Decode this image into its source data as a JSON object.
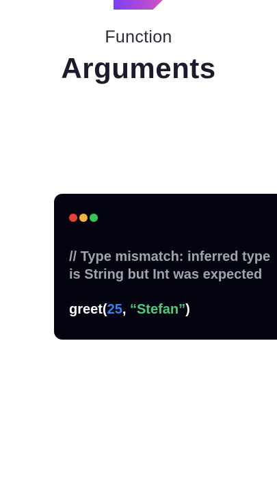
{
  "header": {
    "subtitle": "Function",
    "title": "Arguments"
  },
  "code_card": {
    "comment_line1": "// Type mismatch: inferred type",
    "comment_line2": "is String but Int was expected",
    "call": {
      "func": "greet(",
      "arg1": "25",
      "sep": ", ",
      "arg2": "“Stefan”",
      "close": ")"
    }
  },
  "colors": {
    "number": "#3d7ef0",
    "string": "#4ecb7a",
    "comment": "#a2a4ab",
    "card_bg": "#03040f"
  },
  "icons": [
    "logo-shape",
    "window-dot-red",
    "window-dot-yellow",
    "window-dot-green"
  ]
}
